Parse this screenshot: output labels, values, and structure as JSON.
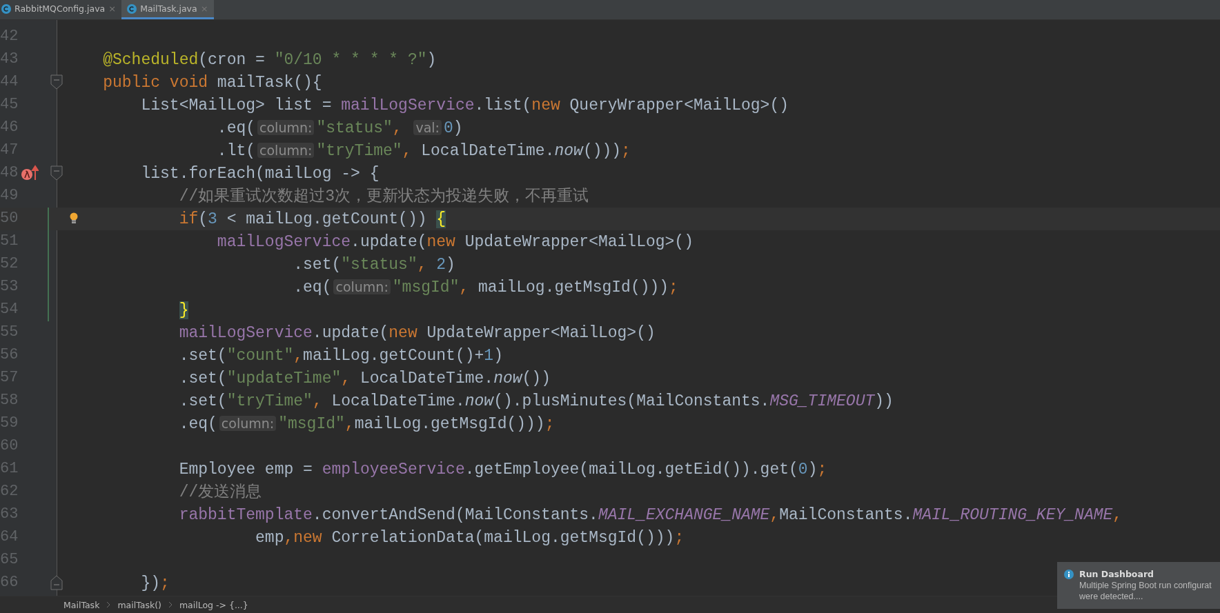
{
  "tabs": [
    {
      "label": "RabbitMQConfig.java",
      "close": "×",
      "selected": false
    },
    {
      "label": "MailTask.java",
      "close": "×",
      "selected": true
    }
  ],
  "lines": [
    {
      "number": "42",
      "kind": "plain",
      "current": false,
      "changed": false
    },
    {
      "number": "43",
      "kind": "plain",
      "current": false,
      "changed": false,
      "tokens": [
        {
          "kind": "annotation",
          "text": "    @Scheduled"
        },
        {
          "kind": "plain",
          "text": "(cron = "
        },
        {
          "kind": "string",
          "text": "\"0/10 * * * * ?\""
        },
        {
          "kind": "plain",
          "text": ")"
        }
      ]
    },
    {
      "number": "44",
      "kind": "fold-start",
      "current": false,
      "changed": false,
      "tokens": [
        {
          "kind": "keyword",
          "text": "    public void "
        },
        {
          "kind": "plain",
          "text": "mailTask(){"
        }
      ]
    },
    {
      "number": "45",
      "kind": "plain",
      "current": false,
      "changed": false,
      "tokens": [
        {
          "kind": "plain",
          "text": "        List<MailLog> list = "
        },
        {
          "kind": "field",
          "text": "mailLogService"
        },
        {
          "kind": "plain",
          "text": ".list("
        },
        {
          "kind": "keyword",
          "text": "new "
        },
        {
          "kind": "plain",
          "text": "QueryWrapper<MailLog>()"
        }
      ]
    },
    {
      "number": "46",
      "kind": "plain",
      "current": false,
      "changed": false,
      "tokens": [
        {
          "kind": "plain",
          "text": "                .eq("
        },
        {
          "kind": "hint",
          "text": "column:"
        },
        {
          "kind": "string",
          "text": "\"status\""
        },
        {
          "kind": "keyword",
          "text": ", "
        },
        {
          "kind": "hint",
          "text": "val:"
        },
        {
          "kind": "number",
          "text": "0"
        },
        {
          "kind": "plain",
          "text": ")"
        }
      ]
    },
    {
      "number": "47",
      "kind": "plain",
      "current": false,
      "changed": false,
      "tokens": [
        {
          "kind": "plain",
          "text": "                .lt("
        },
        {
          "kind": "hint",
          "text": "column:"
        },
        {
          "kind": "string",
          "text": "\"tryTime\""
        },
        {
          "kind": "keyword",
          "text": ", "
        },
        {
          "kind": "plain",
          "text": "LocalDateTime."
        },
        {
          "kind": "static",
          "text": "now"
        },
        {
          "kind": "plain",
          "text": "()))"
        },
        {
          "kind": "keyword",
          "text": ";"
        }
      ]
    },
    {
      "number": "48",
      "kind": "lambda-fold",
      "current": false,
      "changed": false,
      "tokens": [
        {
          "kind": "plain",
          "text": "        list.forEach(mailLog -> {"
        }
      ]
    },
    {
      "number": "49",
      "kind": "plain",
      "current": false,
      "changed": false,
      "tokens": [
        {
          "kind": "comment",
          "text": "            //如果重试次数超过3次，更新状态为投递失败，不再重试"
        }
      ]
    },
    {
      "number": "50",
      "kind": "bulb",
      "current": true,
      "changed": true,
      "tokens": [
        {
          "kind": "keyword",
          "text": "            if"
        },
        {
          "kind": "plain",
          "text": "("
        },
        {
          "kind": "number",
          "text": "3"
        },
        {
          "kind": "plain",
          "text": " < mailLog.getCount()) "
        },
        {
          "kind": "brace",
          "text": "{"
        }
      ]
    },
    {
      "number": "51",
      "kind": "plain",
      "current": false,
      "changed": true,
      "tokens": [
        {
          "kind": "field",
          "text": "                mailLogService"
        },
        {
          "kind": "plain",
          "text": ".update("
        },
        {
          "kind": "keyword",
          "text": "new "
        },
        {
          "kind": "plain",
          "text": "UpdateWrapper<MailLog>()"
        }
      ]
    },
    {
      "number": "52",
      "kind": "plain",
      "current": false,
      "changed": true,
      "tokens": [
        {
          "kind": "plain",
          "text": "                        .set("
        },
        {
          "kind": "string",
          "text": "\"status\""
        },
        {
          "kind": "keyword",
          "text": ", "
        },
        {
          "kind": "number",
          "text": "2"
        },
        {
          "kind": "plain",
          "text": ")"
        }
      ]
    },
    {
      "number": "53",
      "kind": "plain",
      "current": false,
      "changed": true,
      "tokens": [
        {
          "kind": "plain",
          "text": "                        .eq("
        },
        {
          "kind": "hint",
          "text": "column:"
        },
        {
          "kind": "string",
          "text": "\"msgId\""
        },
        {
          "kind": "keyword",
          "text": ", "
        },
        {
          "kind": "plain",
          "text": "mailLog.getMsgId()))"
        },
        {
          "kind": "keyword",
          "text": ";"
        }
      ]
    },
    {
      "number": "54",
      "kind": "plain",
      "current": false,
      "changed": true,
      "tokens": [
        {
          "kind": "brace",
          "text": "            }"
        }
      ]
    },
    {
      "number": "55",
      "kind": "plain",
      "current": false,
      "changed": false,
      "tokens": [
        {
          "kind": "field",
          "text": "            mailLogService"
        },
        {
          "kind": "plain",
          "text": ".update("
        },
        {
          "kind": "keyword",
          "text": "new "
        },
        {
          "kind": "plain",
          "text": "UpdateWrapper<MailLog>()"
        }
      ]
    },
    {
      "number": "56",
      "kind": "plain",
      "current": false,
      "changed": false,
      "tokens": [
        {
          "kind": "plain",
          "text": "            .set("
        },
        {
          "kind": "string",
          "text": "\"count\""
        },
        {
          "kind": "keyword",
          "text": ","
        },
        {
          "kind": "plain",
          "text": "mailLog.getCount()+"
        },
        {
          "kind": "number",
          "text": "1"
        },
        {
          "kind": "plain",
          "text": ")"
        }
      ]
    },
    {
      "number": "57",
      "kind": "plain",
      "current": false,
      "changed": false,
      "tokens": [
        {
          "kind": "plain",
          "text": "            .set("
        },
        {
          "kind": "string",
          "text": "\"updateTime\""
        },
        {
          "kind": "keyword",
          "text": ", "
        },
        {
          "kind": "plain",
          "text": "LocalDateTime."
        },
        {
          "kind": "static",
          "text": "now"
        },
        {
          "kind": "plain",
          "text": "())"
        }
      ]
    },
    {
      "number": "58",
      "kind": "plain",
      "current": false,
      "changed": false,
      "tokens": [
        {
          "kind": "plain",
          "text": "            .set("
        },
        {
          "kind": "string",
          "text": "\"tryTime\""
        },
        {
          "kind": "keyword",
          "text": ", "
        },
        {
          "kind": "plain",
          "text": "LocalDateTime."
        },
        {
          "kind": "static",
          "text": "now"
        },
        {
          "kind": "plain",
          "text": "().plusMinutes(MailConstants."
        },
        {
          "kind": "constant",
          "text": "MSG_TIMEOUT"
        },
        {
          "kind": "plain",
          "text": "))"
        }
      ]
    },
    {
      "number": "59",
      "kind": "plain",
      "current": false,
      "changed": false,
      "tokens": [
        {
          "kind": "plain",
          "text": "            .eq("
        },
        {
          "kind": "hint",
          "text": "column:"
        },
        {
          "kind": "string",
          "text": "\"msgId\""
        },
        {
          "kind": "keyword",
          "text": ","
        },
        {
          "kind": "plain",
          "text": "mailLog.getMsgId()))"
        },
        {
          "kind": "keyword",
          "text": ";"
        }
      ]
    },
    {
      "number": "60",
      "kind": "plain",
      "current": false,
      "changed": false
    },
    {
      "number": "61",
      "kind": "plain",
      "current": false,
      "changed": false,
      "tokens": [
        {
          "kind": "plain",
          "text": "            Employee emp = "
        },
        {
          "kind": "field",
          "text": "employeeService"
        },
        {
          "kind": "plain",
          "text": ".getEmployee(mailLog.getEid()).get("
        },
        {
          "kind": "number",
          "text": "0"
        },
        {
          "kind": "plain",
          "text": ")"
        },
        {
          "kind": "keyword",
          "text": ";"
        }
      ]
    },
    {
      "number": "62",
      "kind": "plain",
      "current": false,
      "changed": false,
      "tokens": [
        {
          "kind": "comment",
          "text": "            //发送消息"
        }
      ]
    },
    {
      "number": "63",
      "kind": "plain",
      "current": false,
      "changed": false,
      "tokens": [
        {
          "kind": "field",
          "text": "            rabbitTemplate"
        },
        {
          "kind": "plain",
          "text": ".convertAndSend(MailConstants."
        },
        {
          "kind": "constant",
          "text": "MAIL_EXCHANGE_NAME"
        },
        {
          "kind": "keyword",
          "text": ","
        },
        {
          "kind": "plain",
          "text": "MailConstants."
        },
        {
          "kind": "constant",
          "text": "MAIL_ROUTING_KEY_NAME"
        },
        {
          "kind": "keyword",
          "text": ","
        }
      ]
    },
    {
      "number": "64",
      "kind": "plain",
      "current": false,
      "changed": false,
      "tokens": [
        {
          "kind": "plain",
          "text": "                    emp"
        },
        {
          "kind": "keyword",
          "text": ","
        },
        {
          "kind": "keyword",
          "text": "new "
        },
        {
          "kind": "plain",
          "text": "CorrelationData(mailLog.getMsgId()))"
        },
        {
          "kind": "keyword",
          "text": ";"
        }
      ]
    },
    {
      "number": "65",
      "kind": "plain",
      "current": false,
      "changed": false
    },
    {
      "number": "66",
      "kind": "fold-end",
      "current": false,
      "changed": false,
      "tokens": [
        {
          "kind": "plain",
          "text": "        })"
        },
        {
          "kind": "keyword",
          "text": ";"
        }
      ]
    }
  ],
  "breadcrumbs": [
    "MailTask",
    "mailTask()",
    "mailLog -> {...}"
  ],
  "notification": {
    "title": "Run Dashboard",
    "lines": [
      "Multiple Spring Boot run configurat",
      "were detected...."
    ]
  }
}
